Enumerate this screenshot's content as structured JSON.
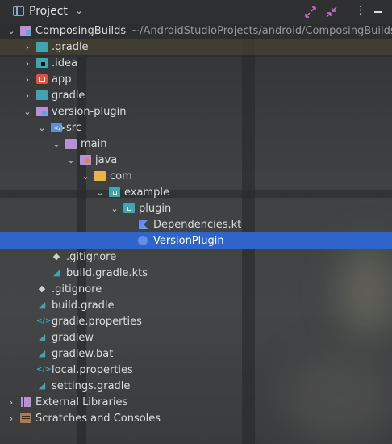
{
  "header": {
    "title": "Project",
    "icons": [
      "project-icon",
      "chevron-down-icon",
      "expand-all-icon",
      "collapse-all-icon",
      "more-options-icon",
      "minimize-icon"
    ]
  },
  "tree": {
    "rows": [
      {
        "label": "ComposingBuilds",
        "path": "~/AndroidStudioProjects/android/ComposingBuilds",
        "icon": "module-folder-icon"
      },
      {
        "label": ".gradle",
        "icon": "gradle-folder-icon"
      },
      {
        "label": ".idea",
        "icon": "idea-folder-icon"
      },
      {
        "label": "app",
        "icon": "app-module-icon"
      },
      {
        "label": "gradle",
        "icon": "gradle-folder-icon"
      },
      {
        "label": "version-plugin",
        "icon": "module-folder-icon"
      },
      {
        "label": "src",
        "icon": "source-folder-icon"
      },
      {
        "label": "main",
        "icon": "folder-icon"
      },
      {
        "label": "java",
        "icon": "java-source-folder-icon"
      },
      {
        "label": "com",
        "icon": "package-folder-icon"
      },
      {
        "label": "example",
        "icon": "package-folder-icon"
      },
      {
        "label": "plugin",
        "icon": "package-folder-icon"
      },
      {
        "label": "Dependencies.kt",
        "icon": "kotlin-file-icon"
      },
      {
        "label": "VersionPlugin",
        "icon": "kotlin-class-icon"
      },
      {
        "label": ".gitignore",
        "icon": "git-ignore-icon"
      },
      {
        "label": "build.gradle.kts",
        "icon": "gradle-file-icon"
      },
      {
        "label": ".gitignore",
        "icon": "git-ignore-icon"
      },
      {
        "label": "build.gradle",
        "icon": "gradle-file-icon"
      },
      {
        "label": "gradle.properties",
        "icon": "properties-file-icon"
      },
      {
        "label": "gradlew",
        "icon": "gradle-file-icon"
      },
      {
        "label": "gradlew.bat",
        "icon": "gradle-file-icon"
      },
      {
        "label": "local.properties",
        "icon": "properties-file-icon"
      },
      {
        "label": "settings.gradle",
        "icon": "gradle-file-icon"
      },
      {
        "label": "External Libraries",
        "icon": "libraries-icon"
      },
      {
        "label": "Scratches and Consoles",
        "icon": "scratches-icon"
      }
    ]
  },
  "colors": {
    "selection": "#2f65ca",
    "gradle_highlight": "#786a3c",
    "path_text": "#9a9a9a",
    "text": "#dcdcdc"
  }
}
